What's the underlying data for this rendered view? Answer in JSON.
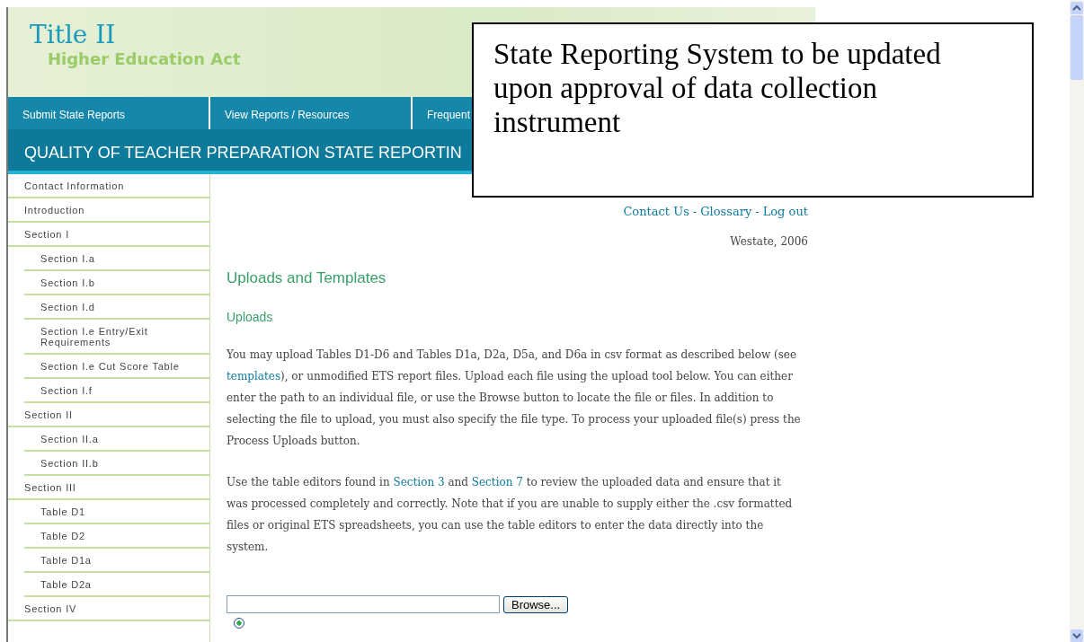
{
  "header": {
    "logo_title": "Title II",
    "logo_subtitle": "Higher Education Act"
  },
  "nav": [
    {
      "label": "Submit State Reports"
    },
    {
      "label": "View Reports / Resources"
    },
    {
      "label": "Frequent"
    }
  ],
  "banner_title": "QUALITY OF TEACHER PREPARATION STATE REPORTIN",
  "notice": "State Reporting System to be updated upon approval of data collection instrument",
  "sidebar": {
    "items": [
      {
        "label": "Contact Information"
      },
      {
        "label": "Introduction"
      },
      {
        "label": "Section I",
        "children": [
          {
            "label": "Section I.a"
          },
          {
            "label": "Section I.b"
          },
          {
            "label": "Section I.d"
          },
          {
            "label": "Section I.e Entry/Exit Requirements"
          },
          {
            "label": "Section I.e Cut Score Table"
          },
          {
            "label": "Section I.f"
          }
        ]
      },
      {
        "label": "Section II",
        "children": [
          {
            "label": "Section II.a"
          },
          {
            "label": "Section II.b"
          }
        ]
      },
      {
        "label": "Section III",
        "children": [
          {
            "label": "Table D1"
          },
          {
            "label": "Table D2"
          },
          {
            "label": "Table D1a"
          },
          {
            "label": "Table D2a"
          }
        ]
      },
      {
        "label": "Section IV"
      }
    ]
  },
  "top_links": [
    {
      "label": "Contact Us"
    },
    {
      "label": "Glossary"
    },
    {
      "label": "Log out"
    }
  ],
  "top_link_separator": "-",
  "state_year": "Westate, 2006",
  "heading": "Uploads and Templates",
  "subheading": "Uploads",
  "paragraphs": [
    [
      {
        "kind": "text",
        "text": "You may upload Tables D1-D6 and Tables D1a, D2a, D5a, and D6a in csv format as described below (see "
      },
      {
        "kind": "link",
        "text": "templates"
      },
      {
        "kind": "text",
        "text": "), or unmodified ETS report files. Upload each file using the upload tool below. You can either enter the path to an individual file, or use the Browse button to locate the file or files. In addition to selecting the file to upload, you must also specify the file type. To process your uploaded file(s) press the Process Uploads button."
      }
    ],
    [
      {
        "kind": "text",
        "text": "Use the table editors found in "
      },
      {
        "kind": "link",
        "text": "Section 3"
      },
      {
        "kind": "text",
        "text": " and "
      },
      {
        "kind": "link",
        "text": "Section 7"
      },
      {
        "kind": "text",
        "text": " to review the uploaded data and ensure that it was processed completely and correctly. Note that if you are unable to supply either the .csv formatted files or original ETS spreadsheets, you can use the table editors to enter the data directly into the system."
      }
    ]
  ],
  "upload": {
    "browse_label": "Browse...",
    "radio_selected": true
  }
}
